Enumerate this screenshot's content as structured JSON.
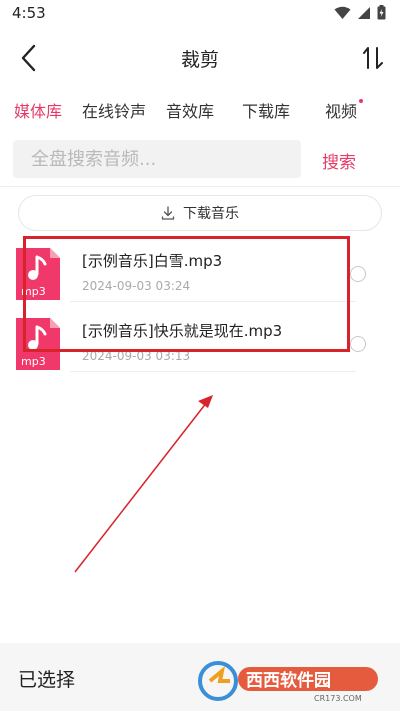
{
  "status_bar": {
    "time": "4:53"
  },
  "header": {
    "title": "裁剪"
  },
  "tabs": [
    {
      "label": "媒体库",
      "active": true
    },
    {
      "label": "在线铃声",
      "active": false
    },
    {
      "label": "音效库",
      "active": false
    },
    {
      "label": "下载库",
      "active": false
    },
    {
      "label": "视频",
      "active": false,
      "dot": true
    }
  ],
  "search": {
    "placeholder": "全盘搜索音频...",
    "value": "",
    "button_label": "搜索"
  },
  "download_button": {
    "label": "下载音乐"
  },
  "files": [
    {
      "name": "[示例音乐]白雪.mp3",
      "date": "2024-09-03  03:24",
      "badge": "mp3"
    },
    {
      "name": "[示例音乐]快乐就是现在.mp3",
      "date": "2024-09-03  03:13",
      "badge": "mp3"
    }
  ],
  "bottom_bar": {
    "selected_label": "已选择"
  },
  "watermark": {
    "text": "西西软件园",
    "domain": "CR173.COM"
  },
  "colors": {
    "accent": "#e63a67",
    "annotation_red": "#d8232a",
    "file_icon": "#f0386a"
  }
}
